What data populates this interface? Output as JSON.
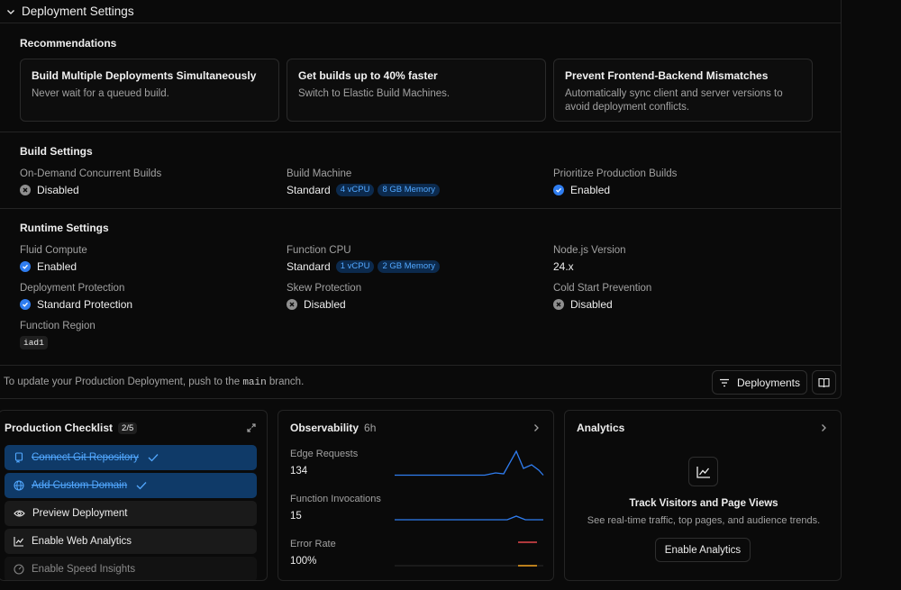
{
  "deployment_settings": {
    "title": "Deployment Settings",
    "recommendations_title": "Recommendations",
    "recommendations": [
      {
        "title": "Build Multiple Deployments Simultaneously",
        "desc": "Never wait for a queued build."
      },
      {
        "title": "Get builds up to 40% faster",
        "desc": "Switch to Elastic Build Machines."
      },
      {
        "title": "Prevent Frontend-Backend Mismatches",
        "desc": "Automatically sync client and server versions to avoid deployment conflicts."
      }
    ],
    "build_title": "Build Settings",
    "build": {
      "concurrent_label": "On-Demand Concurrent Builds",
      "concurrent_value": "Disabled",
      "machine_label": "Build Machine",
      "machine_value": "Standard",
      "machine_cpu": "4 vCPU",
      "machine_mem": "8 GB Memory",
      "prioritize_label": "Prioritize Production Builds",
      "prioritize_value": "Enabled"
    },
    "runtime_title": "Runtime Settings",
    "runtime": {
      "fluid_label": "Fluid Compute",
      "fluid_value": "Enabled",
      "cpu_label": "Function CPU",
      "cpu_value": "Standard",
      "cpu_cpu": "1 vCPU",
      "cpu_mem": "2 GB Memory",
      "node_label": "Node.js Version",
      "node_value": "24.x",
      "protection_label": "Deployment Protection",
      "protection_value": "Standard Protection",
      "skew_label": "Skew Protection",
      "skew_value": "Disabled",
      "coldstart_label": "Cold Start Prevention",
      "coldstart_value": "Disabled",
      "region_label": "Function Region",
      "region_value": "iad1"
    },
    "footer": {
      "text_before": "To update your Production Deployment, push to the ",
      "branch": "main",
      "text_after": " branch.",
      "deployments_button": "Deployments"
    }
  },
  "checklist": {
    "title": "Production Checklist",
    "count": "2/5",
    "items": [
      {
        "label": "Connect Git Repository",
        "done": true,
        "icon": "git-repo-icon"
      },
      {
        "label": "Add Custom Domain",
        "done": true,
        "icon": "globe-icon"
      },
      {
        "label": "Preview Deployment",
        "done": false,
        "icon": "eye-icon"
      },
      {
        "label": "Enable Web Analytics",
        "done": false,
        "icon": "chart-icon"
      },
      {
        "label": "Enable Speed Insights",
        "done": false,
        "icon": "gauge-icon"
      }
    ]
  },
  "observability": {
    "title": "Observability",
    "range": "6h",
    "metrics": [
      {
        "label": "Edge Requests",
        "value": "134"
      },
      {
        "label": "Function Invocations",
        "value": "15"
      },
      {
        "label": "Error Rate",
        "value": "100%"
      }
    ]
  },
  "analytics": {
    "title": "Analytics",
    "heading": "Track Visitors and Page Views",
    "desc": "See real-time traffic, top pages, and audience trends.",
    "button": "Enable Analytics"
  },
  "colors": {
    "accent": "#2f7df0",
    "done_bg": "#0f3a68",
    "error": "#e5484d",
    "warning": "#f5a623"
  }
}
